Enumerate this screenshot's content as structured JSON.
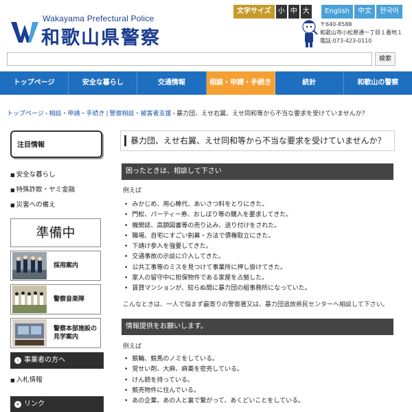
{
  "header": {
    "logo_en": "Wakayama Prefectural Police",
    "logo_ja": "和歌山県警察",
    "font_size_label": "文字サイズ",
    "font_sizes": [
      "小",
      "中",
      "大"
    ],
    "languages": [
      "English",
      "中文",
      "한국어"
    ],
    "address_lines": [
      "〒640-8588",
      "和歌山市小松原通一丁目１番地１",
      "電話:073-423-0110"
    ]
  },
  "search": {
    "value": "",
    "button_label": "検索"
  },
  "nav": {
    "items": [
      "トップページ",
      "安全な暮らし",
      "交通情報",
      "相談・申請・手続き",
      "統計",
      "和歌山の警察"
    ],
    "active_index": 3
  },
  "breadcrumb": {
    "items": [
      "トップページ",
      "相談・申請・手続き",
      "警察相談・被害者支援"
    ],
    "current": "暴力団、えせ右翼、えせ同和等から不当な要求を受けていませんか？"
  },
  "sidebar": {
    "notice_title": "注目情報",
    "links": [
      "安全な暮らし",
      "特殊詐欺・ヤミ金融",
      "災害への備え"
    ],
    "bullet_glyph": "■",
    "junbi_label": "準備中",
    "banners": [
      "採用案内",
      "警察音楽隊",
      "警察本部施設の\n見学案内"
    ],
    "business_head": "事業者の方へ",
    "business_links": [
      "入札情報"
    ],
    "link_head": "リンク"
  },
  "main": {
    "title": "暴力団、えせ右翼、えせ同和等から不当な要求を受けていませんか？",
    "section1": {
      "heading": "困ったときは、相談して下さい",
      "intro": "例えば",
      "items": [
        "みかじめ、用心棒代、あいさつ料をとりにきた。",
        "門松、パーティー券、おしぼり等の購入を要求してきた。",
        "機関誌、高額図書等の売り込み、送り付けをされた。",
        "職場、自宅にすごい剣幕・方法で債権取立にきた。",
        "下請け参入を強要してきた。",
        "交通事故の示談に介入してきた。",
        "公共工事等のミスを見つけて事業所に押し掛けてきた。",
        "家人の留守中に担保物件である家屋を占拠した。",
        "賃貸マンションが、知らぬ間に暴力団の組事務所になっていた。"
      ],
      "closing": "こんなときは、一人で悩まず最寄りの警察署又は、暴力団追放県民センターへ相談して下さい。"
    },
    "section2": {
      "heading": "情報提供をお願いします。",
      "intro": "例えば",
      "items": [
        "競輪、競馬のノミをしている。",
        "覚せい剤、大麻、麻薬を密売している。",
        "けん銃を持っている。",
        "競売物件に住んでいる。",
        "あの企業、あの人と裏で繋がって、あくどいことをしている。"
      ]
    }
  },
  "colors": {
    "brand_blue": "#1a3d8f",
    "nav_blue": "#1f6fc0",
    "nav_active": "#f5a033",
    "font_size_gold": "#c79a2a",
    "lang_blue": "#4aa0d8",
    "section_dark": "#444444"
  }
}
